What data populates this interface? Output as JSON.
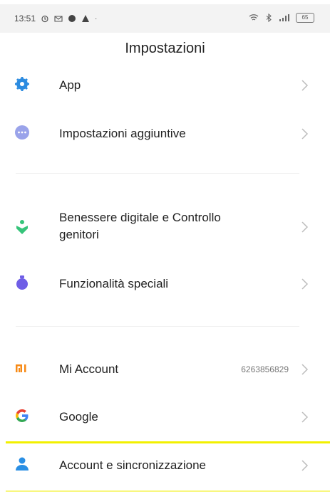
{
  "status_bar": {
    "time": "13:51",
    "battery": "65"
  },
  "header": {
    "title": "Impostazioni"
  },
  "items": [
    {
      "label": "App",
      "icon": "gear-icon",
      "color": "#2b8be0"
    },
    {
      "label": "Impostazioni aggiuntive",
      "icon": "more-dots-icon",
      "color": "#9aa3ea"
    },
    {
      "label_line1": "Benessere digitale e Controllo",
      "label_line2": "genitori",
      "icon": "wellbeing-icon",
      "color": "#36c47a"
    },
    {
      "label": "Funzionalità speciali",
      "icon": "special-features-icon",
      "color": "#6f5ee6"
    },
    {
      "label": "Mi Account",
      "value": "6263856829",
      "icon": "mi-logo-icon",
      "color": "#f78a16"
    },
    {
      "label": "Google",
      "icon": "google-g-icon"
    },
    {
      "label": "Account e sincronizzazione",
      "icon": "account-person-icon",
      "color": "#2a8fe4"
    }
  ],
  "colors": {
    "highlight": "#f2f000",
    "chevron": "#bdbdbd"
  }
}
